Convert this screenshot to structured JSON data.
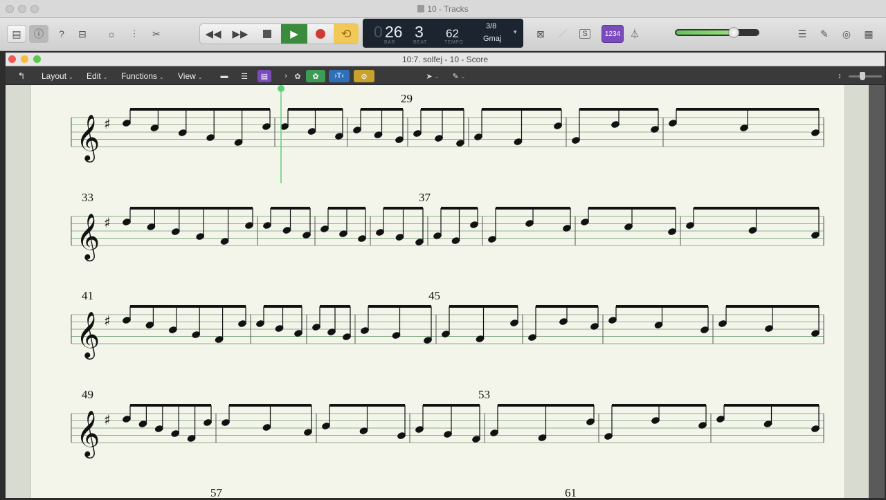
{
  "main_window": {
    "title": "10 - Tracks"
  },
  "control_bar": {
    "lcd": {
      "bar": "26",
      "bar_prefix": "0",
      "beat": "3",
      "bar_label": "BAR",
      "beat_label": "BEAT",
      "tempo": "62",
      "tempo_label": "TEMPO",
      "time_signature": "3/8",
      "key": "Gmaj"
    },
    "count_in_label": "1234",
    "volume_level": 0.7,
    "accent_color": "#3a8c3c",
    "record_color": "#d03a33",
    "cycle_color": "#e8b43a"
  },
  "score_window": {
    "title": "10:7. solfej - 10 - Score",
    "menus": [
      "Layout",
      "Edit",
      "Functions",
      "View"
    ]
  },
  "score": {
    "bar_numbers": [
      "29",
      "33",
      "37",
      "41",
      "45",
      "49",
      "53",
      "57",
      "61"
    ],
    "playhead_color": "#5fd07a"
  }
}
